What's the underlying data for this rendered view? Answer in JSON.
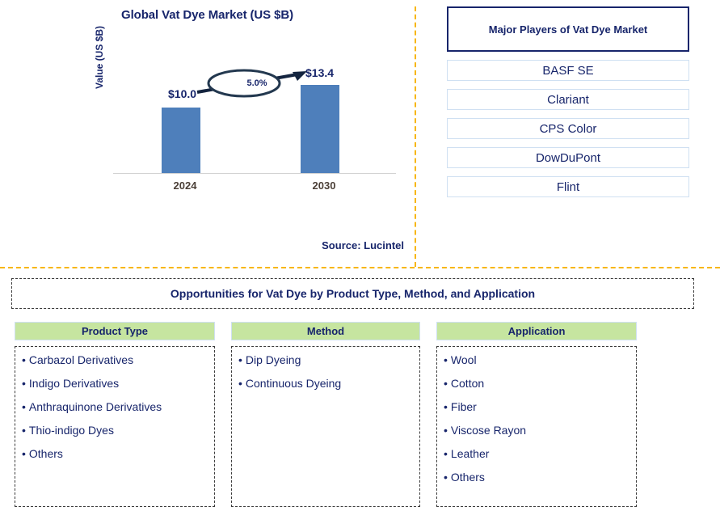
{
  "chart_panel": {
    "title": "Global Vat Dye Market (US $B)",
    "y_axis_label": "Value (US $B)",
    "source": "Source: Lucintel",
    "cagr_label": "5.0%"
  },
  "chart_data": {
    "type": "bar",
    "title": "Global Vat Dye Market (US $B)",
    "xlabel": "",
    "ylabel": "Value (US $B)",
    "categories": [
      "2024",
      "2030"
    ],
    "values": [
      10.0,
      13.4
    ],
    "value_labels": [
      "$10.0",
      "$13.4"
    ],
    "annotations": [
      {
        "text": "5.0%",
        "kind": "cagr-callout",
        "from": "2024",
        "to": "2030"
      }
    ],
    "ylim": [
      0,
      15.8
    ],
    "grid": false,
    "legend": false,
    "bar_color": "#4e7fbb",
    "source": "Source: Lucintel"
  },
  "players": {
    "header": "Major Players of Vat Dye Market",
    "items": [
      "BASF SE",
      "Clariant",
      "CPS Color",
      "DowDuPont",
      "Flint"
    ]
  },
  "opportunities": {
    "banner_title": "Opportunities for Vat Dye by Product Type, Method, and Application",
    "columns": [
      {
        "header": "Product Type",
        "items": [
          "Carbazol Derivatives",
          "Indigo Derivatives",
          "Anthraquinone Derivatives",
          "Thio-indigo Dyes",
          "Others"
        ]
      },
      {
        "header": "Method",
        "items": [
          "Dip Dyeing",
          "Continuous Dyeing"
        ]
      },
      {
        "header": "Application",
        "items": [
          "Wool",
          "Cotton",
          "Fiber",
          "Viscose Rayon",
          "Leather",
          "Others"
        ]
      }
    ]
  },
  "colors": {
    "navy": "#17256b",
    "bar_blue": "#4e7fbb",
    "divider_yellow": "#f7b60c",
    "header_green": "#c6e5a0",
    "box_border_blue": "#cfe0f2"
  },
  "bullet": "•"
}
